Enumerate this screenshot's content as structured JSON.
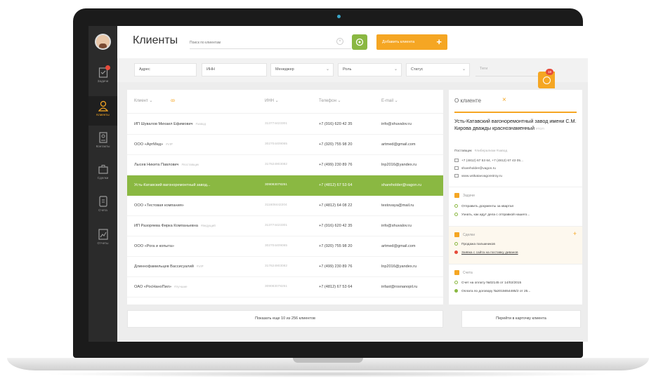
{
  "colors": {
    "accent": "#f5a623",
    "success": "#8ab842",
    "danger": "#e64b3b",
    "sidebar": "#2b2b2b"
  },
  "sidebar": {
    "items": [
      {
        "label": "Задачи",
        "icon": "clipboard-icon",
        "badge": true
      },
      {
        "label": "Клиенты",
        "icon": "user-icon",
        "active": true
      },
      {
        "label": "Контакты",
        "icon": "contact-card-icon"
      },
      {
        "label": "Сделки",
        "icon": "briefcase-icon"
      },
      {
        "label": "Счета",
        "icon": "invoice-icon"
      },
      {
        "label": "Отчеты",
        "icon": "chart-icon"
      }
    ]
  },
  "header": {
    "title": "Клиенты",
    "search_placeholder": "Поиск по клиентам",
    "add_button": "Добавить клиента",
    "add_plus": "+"
  },
  "filters": {
    "address": "Адрес",
    "inn": "ИНН",
    "manager": "Менеджер",
    "role": "Роль",
    "status": "Статус",
    "tags": "Теги",
    "caret": "⌄",
    "notification_count": "18"
  },
  "table": {
    "headers": {
      "client": "Клиент ⌄",
      "filter": "ꝏ",
      "inn": "ИНН ⌄",
      "phone": "Телефон ⌄",
      "email": "E-mail ⌄"
    },
    "rows": [
      {
        "name": "ИП Шувалов Михаил Ефимович",
        "tag": "#завод",
        "inn": "313774423301",
        "phone": "+7 (916) 620 42 35",
        "email": "info@shuvalov.ru"
      },
      {
        "name": "ООО «АртМед»",
        "tag": "#VIP",
        "inn": "302704409065",
        "phone": "+7 (920) 755 98 20",
        "email": "artmed@gmail.com"
      },
      {
        "name": "Лысев Никита Павлович",
        "tag": "#поставщик",
        "inn": "317624903082",
        "phone": "+7 (499) 230 89 76",
        "email": "lnp2016@yandex.ru"
      },
      {
        "name": "Усть-Катавский вагоноремонтный завод...",
        "tag": "",
        "inn": "309083078251",
        "phone": "+7 (4812) 67 53 64",
        "email": "shareholder@vagon.ru",
        "selected": true
      },
      {
        "name": "ООО «Тестовая компания»",
        "tag": "",
        "inn": "311608442204",
        "phone": "+7 (4812) 64 08 22",
        "email": "testovaya@mail.ru"
      },
      {
        "name": "ИП Разоряева Фирка Компаньевна",
        "tag": "#ведущий",
        "inn": "313774423301",
        "phone": "+7 (916) 620 42 35",
        "email": "info@shuvalov.ru"
      },
      {
        "name": "ООО «Рога и копыта»",
        "tag": "",
        "inn": "302704409065",
        "phone": "+7 (920) 755 98 20",
        "email": "artmed@gmail.com"
      },
      {
        "name": "Длиннофамильцев Вассисуалий",
        "tag": "#VIP",
        "inn": "317624903082",
        "phone": "+7 (499) 230 89 76",
        "email": "lnp2016@yandex.ru"
      },
      {
        "name": "ОАО «РосНаноПил»",
        "tag": "#лучшие",
        "inn": "309083078251",
        "phone": "+7 (4812) 67 53 64",
        "email": "infast@rosnanopil.ru"
      }
    ],
    "show_more": "Показать еще 10 из 256 клиентов"
  },
  "detail": {
    "title": "О клиенте",
    "close": "×",
    "company": "Усть-Катавский вагоноремонтный завод имени С.М. Кирова дважды краснознаменный",
    "company_tag": "#ТОП",
    "role_label": "Поставщик",
    "role_tags": "#либерализм #завод",
    "phones": "+7 (4812) 67 53 64, +7 (4812) 67 43 05...",
    "email": "shareholder@vagon.ru",
    "site": "www.ustkatavvagonstroy.ru",
    "tasks": {
      "label": "Задачи",
      "items": [
        {
          "text": "Отправить документы за квартал",
          "state": "open"
        },
        {
          "text": "Узнать, как идут дела с отправкой нашего...",
          "state": "open"
        }
      ]
    },
    "deals": {
      "label": "Сделки",
      "plus": "+",
      "items": [
        {
          "text": "Продажа пальмников",
          "state": "open"
        },
        {
          "text": "Заявка с сайта на поставку диванов",
          "state": "alert"
        }
      ]
    },
    "invoices": {
      "label": "Счета",
      "items": [
        {
          "text": "Счет на оплату №02145 от 14/02/2015",
          "state": "open"
        },
        {
          "text": "Оплата по договору №2015654485/2 от 25...",
          "state": "done"
        }
      ]
    },
    "goto_card": "Перейти в карточку клиента"
  }
}
